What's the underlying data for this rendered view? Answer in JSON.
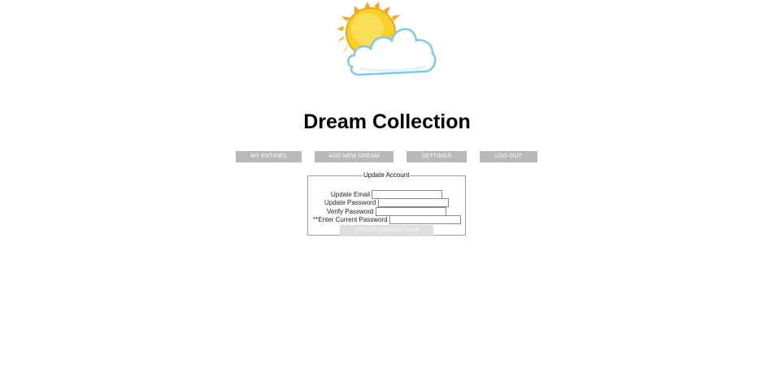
{
  "logo": {
    "icon": "sun-behind-cloud-icon",
    "sun_color": "#f7c21a",
    "ray_color": "#f4a623",
    "cloud_outline": "#7ec8e8"
  },
  "header": {
    "title": "Dream Collection"
  },
  "nav": {
    "items": [
      {
        "label": "MY ENTRIES"
      },
      {
        "label": "ADD NEW DREAM"
      },
      {
        "label": "SETTINGS"
      },
      {
        "label": "LOG-OUT"
      }
    ],
    "button_color": "#b9b9b9"
  },
  "account_form": {
    "legend": "Update Account",
    "fields": [
      {
        "label": "Update Email",
        "value": ""
      },
      {
        "label": "Update Password",
        "value": ""
      },
      {
        "label": "Verify Password",
        "value": ""
      },
      {
        "label": "**Enter Current Password",
        "value": ""
      }
    ],
    "submit_label": "UPDATE CREDENTIALS"
  }
}
